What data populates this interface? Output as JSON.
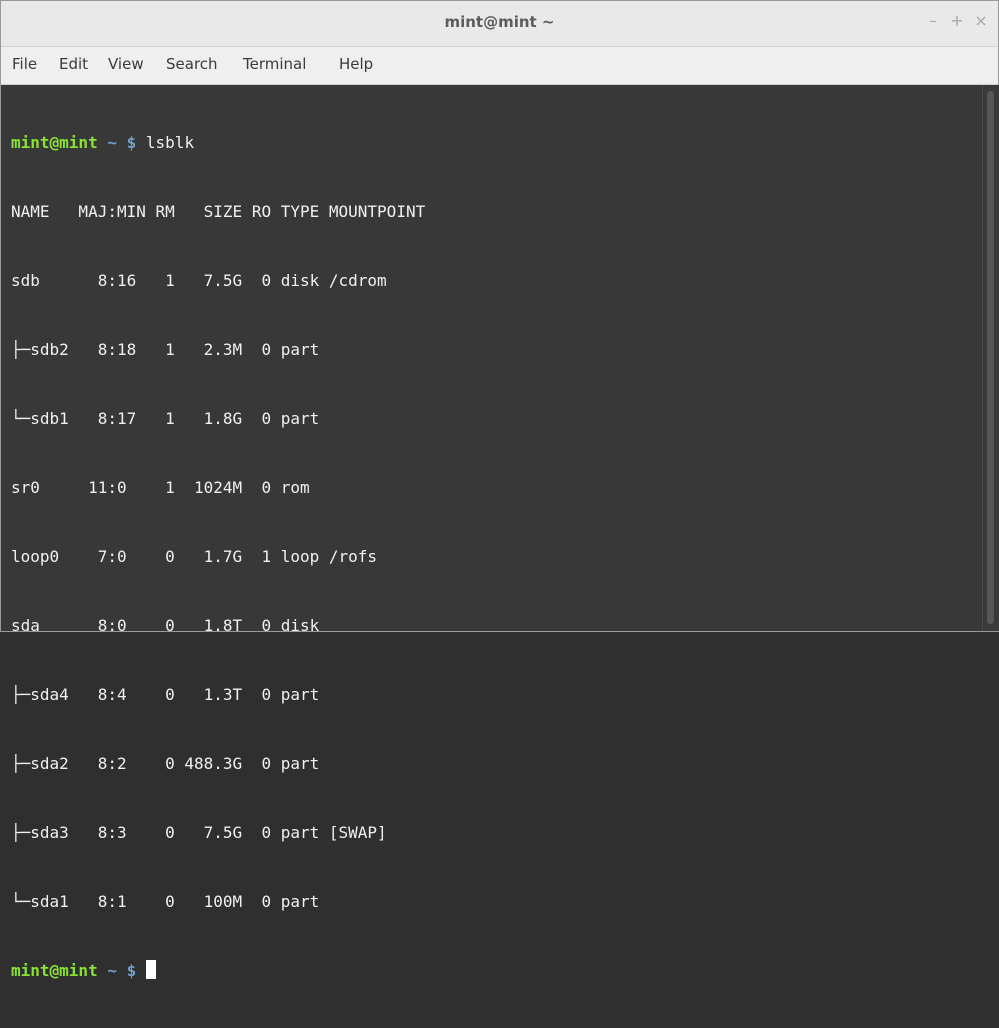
{
  "window": {
    "title": "mint@mint ~"
  },
  "controls": {
    "minimize": "–",
    "maximize": "+",
    "close": "×"
  },
  "menu": [
    "File",
    "Edit",
    "View",
    "Search",
    "Terminal",
    "Help"
  ],
  "prompt": {
    "user_host": "mint@mint",
    "path": "~",
    "symbol": "$"
  },
  "command": "lsblk",
  "output": [
    "NAME   MAJ:MIN RM   SIZE RO TYPE MOUNTPOINT",
    "sdb      8:16   1   7.5G  0 disk /cdrom",
    "├─sdb2   8:18   1   2.3M  0 part ",
    "└─sdb1   8:17   1   1.8G  0 part ",
    "sr0     11:0    1  1024M  0 rom  ",
    "loop0    7:0    0   1.7G  1 loop /rofs",
    "sda      8:0    0   1.8T  0 disk ",
    "├─sda4   8:4    0   1.3T  0 part ",
    "├─sda2   8:2    0 488.3G  0 part ",
    "├─sda3   8:3    0   7.5G  0 part [SWAP]",
    "└─sda1   8:1    0   100M  0 part "
  ],
  "colors": {
    "terminal_bg": "#383838",
    "prompt_user": "#8ae234",
    "prompt_path": "#729fcf",
    "text": "#f0f0f0"
  }
}
